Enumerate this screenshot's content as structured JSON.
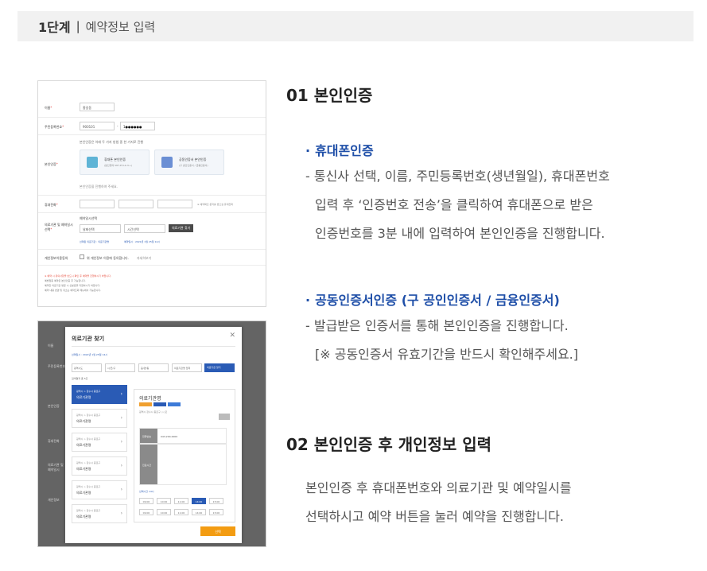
{
  "step": {
    "label": "1단계",
    "separator": "|",
    "title": "예약정보 입력"
  },
  "section1": {
    "title": "01 본인인증",
    "phone": {
      "title": "휴대폰인증",
      "lines": [
        "- 통신사 선택, 이름, 주민등록번호(생년월일), 휴대폰번호",
        "입력 후 ‘인증번호 전송’을 클릭하여 휴대폰으로 받은",
        "인증번호를 3분 내에 입력하여 본인인증을 진행합니다."
      ]
    },
    "cert": {
      "title": "공동인증서인증 (구 공인인증서 / 금융인증서)",
      "lines": [
        "- 발급받은 인증서를 통해 본인인증을 진행합니다.",
        "[※ 공동인증서 유효기간을 반드시 확인해주세요.]"
      ]
    }
  },
  "section2": {
    "title": "02 본인인증 후 개인정보 입력",
    "lines": [
      "본인인증 후 휴대폰번호와 의료기관 및 예약일시를",
      "선택하시고 예약 버튼을 눌러 예약을 진행합니다."
    ]
  },
  "shot1": {
    "name_label": "이름",
    "name_value": "홍길동",
    "rrn_label": "주민등록번호",
    "rrn_front": "900101",
    "rrn_back": "1●●●●●●",
    "auth_label": "본인인증",
    "auth_hint": "본인인증은 아래 두 가지 방법 중 한 가지로 진행",
    "phone_card_title": "휴대폰 본인인증",
    "phone_card_sub": "(본인명의 SKT,KT,LG U+)",
    "cert_card_title": "공동인증서 본인인증",
    "cert_card_sub": "(구 공인인증서 / 금융인증서)",
    "auth_note": "본인인증을 진행하여 주세요.",
    "phone_label": "휴대전화",
    "phone_note": "※ 예약확인 문자를 받으실 휴대전화",
    "org_label": "의료기관 및 예약일시 선택",
    "org_sub": "예약일시선택",
    "date_placeholder": "날짜선택",
    "time_placeholder": "시간선택",
    "org_btn": "의료기관 찾기",
    "org_selected": "선택된 의료기관 : 의료기관명",
    "org_date": "예약일시 : 2022년 1월 25일 14시",
    "consent_label": "개인정보이용동의",
    "consent_text": "위 개인정보 이용에 동의합니다.",
    "consent_link": "자세히보기",
    "notes": [
      "※ 예약 시 유의사항을 반드시 확인 후 예약을 진행하시기 바랍니다.",
      "예방접종 예약은 본인인증 후 가능합니다.",
      "예약한 의료기관 방문 시 신분증을 지참하시기 바랍니다.",
      "예약 내용 변경 및 취소는 예약조회 메뉴에서 가능합니다."
    ]
  },
  "shot2": {
    "modal_title": "의료기관 찾기",
    "date_line": "선택일시 : 2022년 1월 25일 14시",
    "sel1": "광역시도",
    "sel2": "시/군/구",
    "sel3": "읍/면/동",
    "sel4": "의료기관명 입력",
    "search_btn": "의료기관 찾기",
    "result_count": "검색결과 총 5곳",
    "list_sub": "광역시 > 장수시 종로구",
    "list_name": "의료기관명",
    "detail_title": "의료기관명",
    "detail_addr": "광역시 장수시 종로구 ◇◇로",
    "phone_head": "전화번호",
    "phone_val": "043-200-0000",
    "hours_head": "진료시간",
    "time_title": "선택시간 14시",
    "times": [
      "09:00",
      "10:00",
      "11:00",
      "14:00",
      "15:00",
      "09:00",
      "10:00",
      "11:00",
      "14:00",
      "15:00"
    ],
    "select_btn": "선택",
    "bg_labels": [
      "이름",
      "주민등록번호",
      "본인인증",
      "휴대전화",
      "의료기관 및 예약일시",
      "개인정보"
    ]
  }
}
